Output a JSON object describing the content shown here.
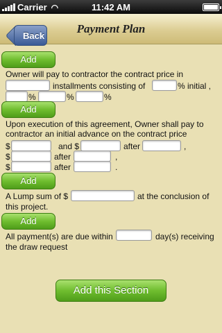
{
  "status": {
    "carrier": "Carrier",
    "time": "11:42 AM"
  },
  "nav": {
    "title": "Payment Plan",
    "back": "Back"
  },
  "buttons": {
    "add": "Add",
    "add_section": "Add this Section"
  },
  "section1": {
    "line1": "Owner will pay to contractor the contract price in",
    "installments": "installments consisting of",
    "pct_initial": "% initial ,",
    "pct": "%",
    "pct2": "%",
    "pct3": "%"
  },
  "section2": {
    "line1": "Upon execution of this agreement, Owner shall pay to",
    "line2": "contractor an initial advance on the contract price",
    "dollar": "$",
    "and": "and $",
    "after": "after",
    "comma": ",",
    "period": "."
  },
  "section3": {
    "lump": "A Lump sum of $",
    "conclusion": "at the conclusion of",
    "project": "this project."
  },
  "section4": {
    "due": "All payment(s) are due within",
    "days": "day(s) receiving",
    "draw": "the draw request"
  },
  "colors": {
    "background": "#e9e0b4",
    "button_green": "#6fbd2f",
    "nav_blue": "#3a5a96"
  }
}
